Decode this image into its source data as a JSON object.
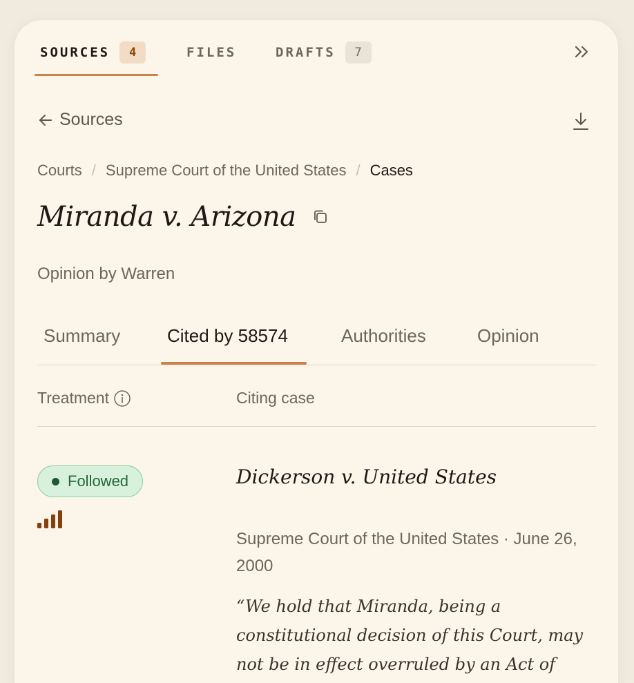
{
  "top_tabs": [
    {
      "label": "SOURCES",
      "badge": "4",
      "active": true
    },
    {
      "label": "FILES",
      "badge": null,
      "active": false
    },
    {
      "label": "DRAFTS",
      "badge": "7",
      "active": false
    }
  ],
  "back": {
    "label": "Sources"
  },
  "breadcrumb": [
    "Courts",
    "Supreme Court of the United States",
    "Cases"
  ],
  "title": "Miranda v. Arizona",
  "opinion_by": "Opinion by Warren",
  "content_tabs": [
    {
      "label": "Summary"
    },
    {
      "label": "Cited by 58574"
    },
    {
      "label": "Authorities"
    },
    {
      "label": "Opinion"
    }
  ],
  "table": {
    "headers": {
      "treatment": "Treatment",
      "citing_case": "Citing case"
    },
    "rows": [
      {
        "treatment": "Followed",
        "strength_bars": 4,
        "case_name": "Dickerson v. United States",
        "meta": "Supreme Court of the United States · June 26, 2000",
        "quote": "“We hold that Miranda, being a constitutional decision of this Court, may not be in effect overruled by an Act of"
      }
    ]
  },
  "colors": {
    "background": "#f1ebdf",
    "panel": "#fbf5ea",
    "accent": "#c9824a",
    "followed_bg": "#d8f1dc",
    "followed_text": "#24663a",
    "signal": "#8a3e0c"
  },
  "icons": {
    "collapse": "double-chevron-right-icon",
    "back": "arrow-left-icon",
    "download": "download-icon",
    "copy": "copy-icon",
    "info": "info-icon",
    "signal": "signal-bars-icon"
  }
}
